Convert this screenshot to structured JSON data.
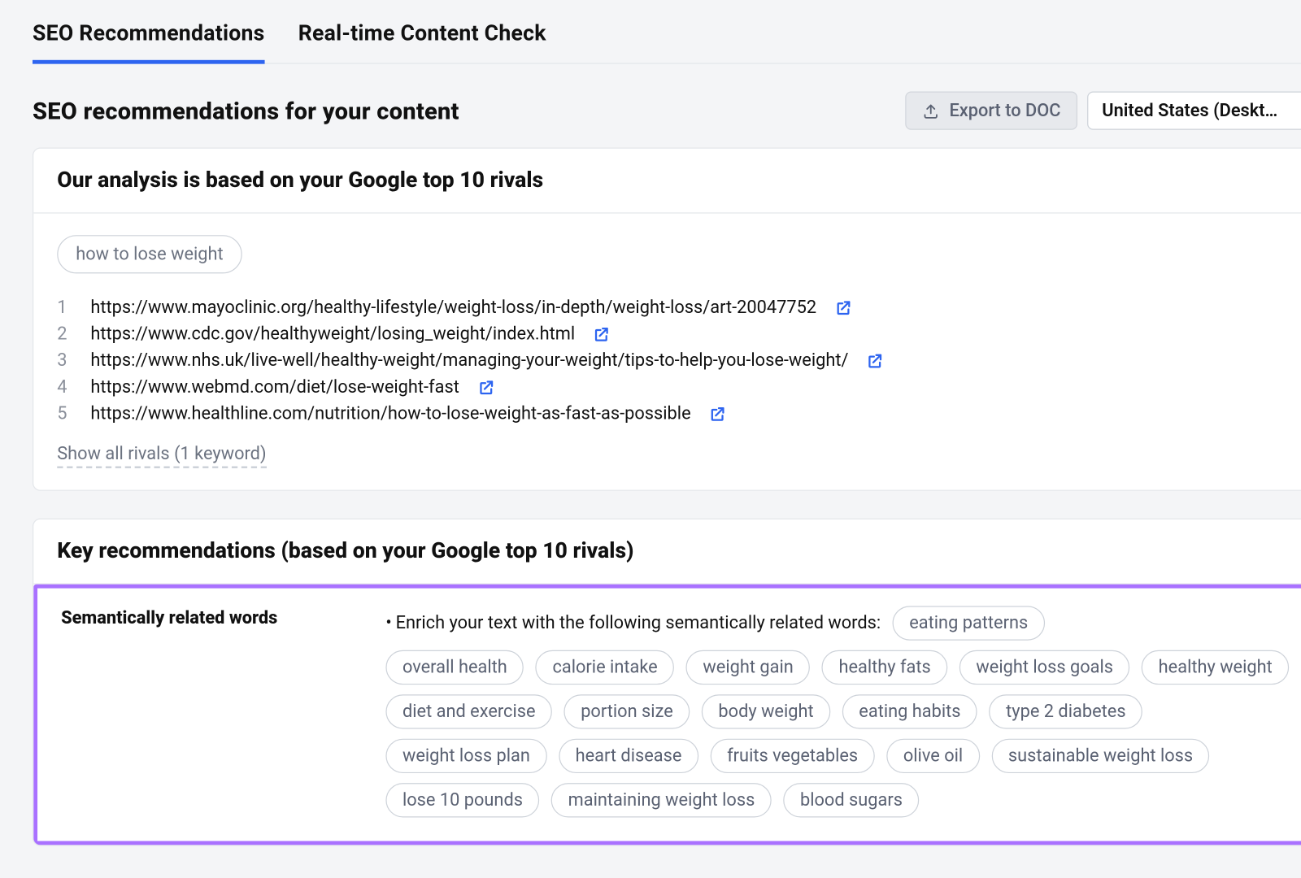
{
  "tabs": [
    {
      "label": "SEO Recommendations",
      "active": true
    },
    {
      "label": "Real-time Content Check",
      "active": false
    }
  ],
  "page_title": "SEO recommendations for your content",
  "export_button": "Export to DOC",
  "locale_selector": "United States (Deskt…",
  "analysis_card": {
    "title": "Our analysis is based on your Google top 10 rivals",
    "keyword": "how to lose weight",
    "rivals": [
      {
        "n": "1",
        "url": "https://www.mayoclinic.org/healthy-lifestyle/weight-loss/in-depth/weight-loss/art-20047752"
      },
      {
        "n": "2",
        "url": "https://www.cdc.gov/healthyweight/losing_weight/index.html"
      },
      {
        "n": "3",
        "url": "https://www.nhs.uk/live-well/healthy-weight/managing-your-weight/tips-to-help-you-lose-weight/"
      },
      {
        "n": "4",
        "url": "https://www.webmd.com/diet/lose-weight-fast"
      },
      {
        "n": "5",
        "url": "https://www.healthline.com/nutrition/how-to-lose-weight-as-fast-as-possible"
      }
    ],
    "show_all": "Show all rivals (1 keyword)"
  },
  "key_rec": {
    "title": "Key recommendations (based on your Google top 10 rivals)",
    "section_label": "Semantically related words",
    "lead_text": "Enrich your text with the following semantically related words:",
    "words": [
      "eating patterns",
      "overall health",
      "calorie intake",
      "weight gain",
      "healthy fats",
      "weight loss goals",
      "healthy weight",
      "diet and exercise",
      "portion size",
      "body weight",
      "eating habits",
      "type 2 diabetes",
      "weight loss plan",
      "heart disease",
      "fruits vegetables",
      "olive oil",
      "sustainable weight loss",
      "lose 10 pounds",
      "maintaining weight loss",
      "blood sugars"
    ]
  }
}
